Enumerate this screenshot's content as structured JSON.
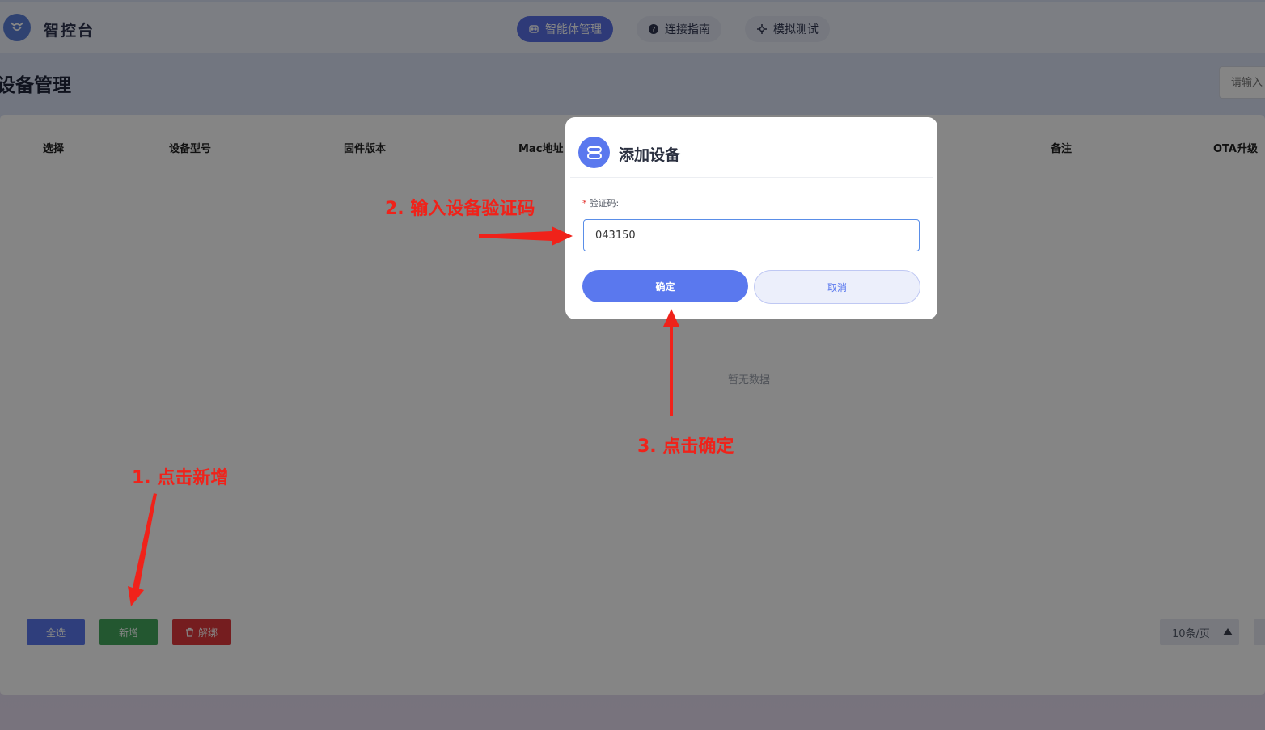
{
  "header": {
    "brand": "智控台",
    "nav": [
      {
        "label": "智能体管理",
        "icon": "robot-icon",
        "active": true
      },
      {
        "label": "连接指南",
        "icon": "help-circle-icon",
        "active": false
      },
      {
        "label": "模拟测试",
        "icon": "plug-icon",
        "active": false
      }
    ]
  },
  "page": {
    "title": "设备管理",
    "search_placeholder": "请输入"
  },
  "table": {
    "columns": [
      "选择",
      "设备型号",
      "固件版本",
      "Mac地址",
      "备注",
      "OTA升级"
    ],
    "empty_text": "暂无数据"
  },
  "actions": {
    "select_all": "全选",
    "add": "新增",
    "unbind": "解绑"
  },
  "pagination": {
    "page_size_label": "10条/页"
  },
  "modal": {
    "title": "添加设备",
    "field_label": "验证码:",
    "field_value": "043150",
    "confirm_label": "确定",
    "cancel_label": "取消"
  },
  "annotations": {
    "step1": "1. 点击新增",
    "step2": "2. 输入设备验证码",
    "step3": "3. 点击确定"
  },
  "colors": {
    "primary": "#5a78ee",
    "success": "#43a85c",
    "danger": "#e1393c",
    "annotation": "#f0221a"
  }
}
